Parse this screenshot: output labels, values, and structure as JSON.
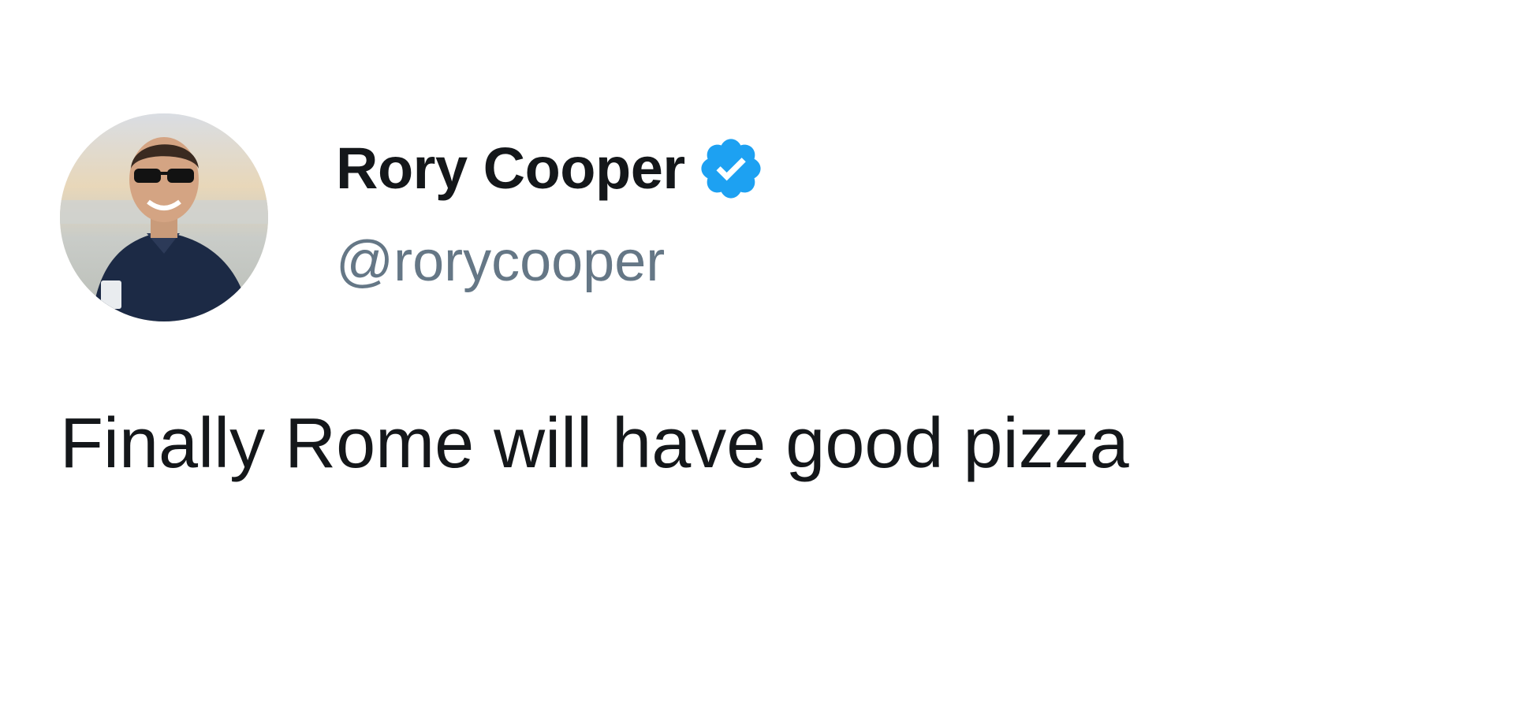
{
  "tweet": {
    "author": {
      "display_name": "Rory Cooper",
      "handle": "@rorycooper",
      "verified": true,
      "avatar_icon": "profile-photo",
      "badge_icon": "verified-badge-icon"
    },
    "text": "Finally Rome will have good pizza"
  },
  "colors": {
    "background": "#ffffff",
    "name_text": "#14171a",
    "handle_text": "#657786",
    "verified_blue": "#1da1f2"
  }
}
